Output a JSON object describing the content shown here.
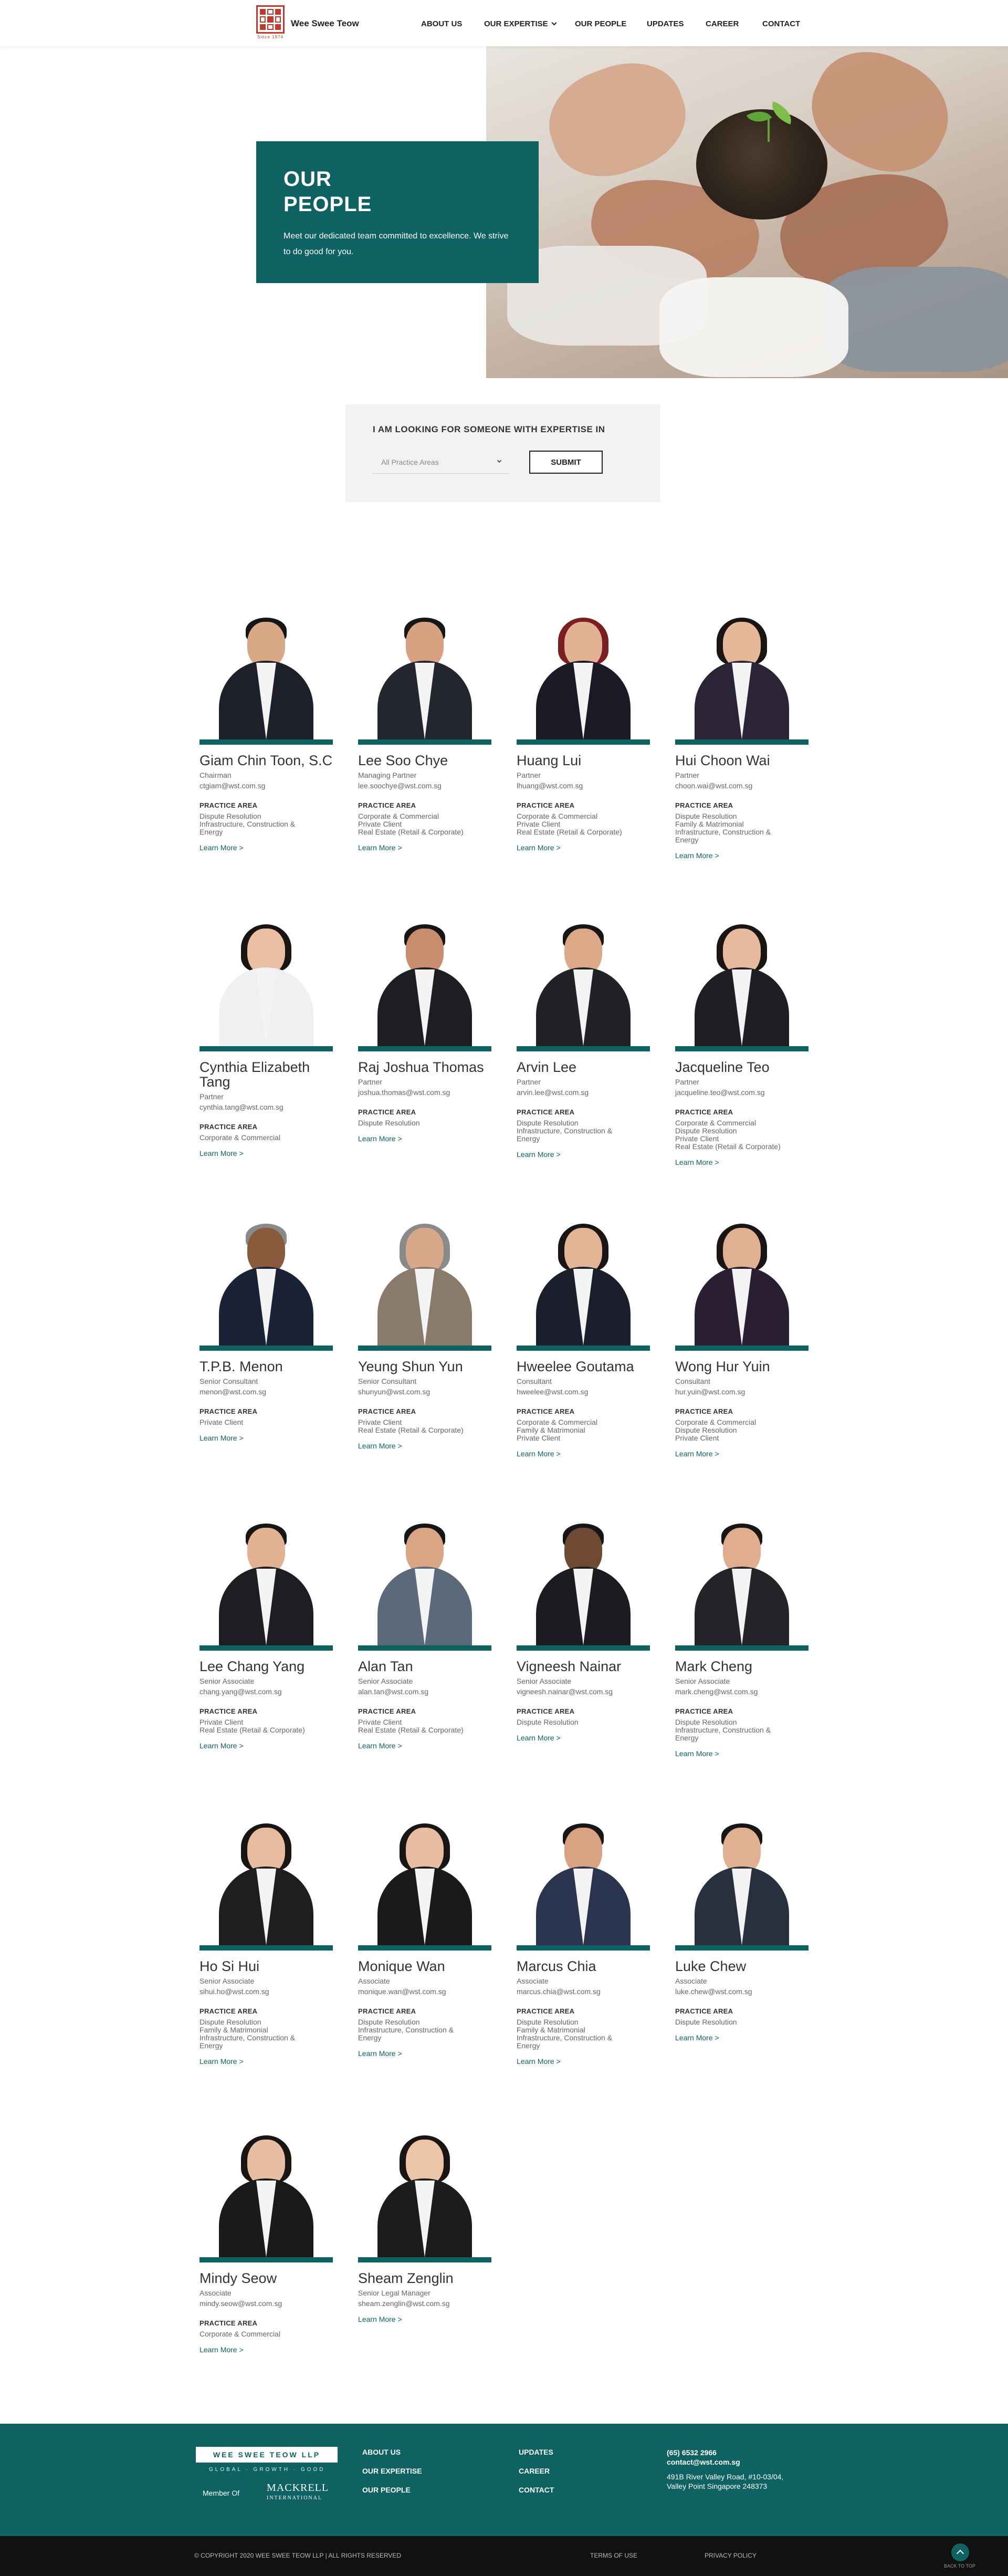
{
  "header": {
    "brand": "Wee Swee Teow",
    "logo_sub": "Since 1974",
    "nav": [
      "ABOUT US",
      "OUR EXPERTISE",
      "OUR PEOPLE",
      "UPDATES",
      "CAREER",
      "CONTACT"
    ]
  },
  "hero": {
    "title_line1": "OUR",
    "title_line2": "PEOPLE",
    "description": "Meet our dedicated team committed to excellence. We strive to do good for you."
  },
  "filter": {
    "title": "I AM LOOKING FOR SOMEONE WITH EXPERTISE IN",
    "selected": "All Practice Areas",
    "submit_label": "SUBMIT"
  },
  "labels": {
    "practice_area": "PRACTICE AREA",
    "learn_more": "Learn More >"
  },
  "people": [
    {
      "name": "Giam Chin Toon, S.C",
      "role": "Chairman",
      "email": "ctgiam@wst.com.sg",
      "areas": [
        "Dispute Resolution",
        "Infrastructure, Construction &",
        "Energy"
      ]
    },
    {
      "name": "Lee Soo Chye",
      "role": "Managing Partner",
      "email": "lee.soochye@wst.com.sg",
      "areas": [
        "Corporate & Commercial",
        "Private Client",
        "Real Estate (Retail & Corporate)"
      ]
    },
    {
      "name": "Huang Lui",
      "role": "Partner",
      "email": "lhuang@wst.com.sg",
      "areas": [
        "Corporate & Commercial",
        "Private Client",
        "Real Estate (Retail & Corporate)"
      ]
    },
    {
      "name": "Hui Choon Wai",
      "role": "Partner",
      "email": "choon.wai@wst.com.sg",
      "areas": [
        "Dispute Resolution",
        "Family & Matrimonial",
        "Infrastructure, Construction &",
        "Energy"
      ]
    },
    {
      "name": "Cynthia Elizabeth Tang",
      "role": "Partner",
      "email": "cynthia.tang@wst.com.sg",
      "areas": [
        "Corporate & Commercial"
      ]
    },
    {
      "name": "Raj Joshua Thomas",
      "role": "Partner",
      "email": "joshua.thomas@wst.com.sg",
      "areas": [
        "Dispute Resolution"
      ]
    },
    {
      "name": "Arvin Lee",
      "role": "Partner",
      "email": "arvin.lee@wst.com.sg",
      "areas": [
        "Dispute Resolution",
        "Infrastructure, Construction &",
        "Energy"
      ]
    },
    {
      "name": "Jacqueline Teo",
      "role": "Partner",
      "email": "jacqueline.teo@wst.com.sg",
      "areas": [
        "Corporate & Commercial",
        "Dispute Resolution",
        "Private Client",
        "Real Estate (Retail & Corporate)"
      ]
    },
    {
      "name": "T.P.B. Menon",
      "role": "Senior Consultant",
      "email": "menon@wst.com.sg",
      "areas": [
        "Private Client"
      ]
    },
    {
      "name": "Yeung Shun Yun",
      "role": "Senior Consultant",
      "email": "shunyun@wst.com.sg",
      "areas": [
        "Private Client",
        "Real Estate (Retail & Corporate)"
      ]
    },
    {
      "name": "Hweelee Goutama",
      "role": "Consultant",
      "email": "hweelee@wst.com.sg",
      "areas": [
        "Corporate & Commercial",
        "Family & Matrimonial",
        "Private Client"
      ]
    },
    {
      "name": "Wong Hur Yuin",
      "role": "Consultant",
      "email": "hur.yuin@wst.com.sg",
      "areas": [
        "Corporate & Commercial",
        "Dispute Resolution",
        "Private Client"
      ]
    },
    {
      "name": "Lee Chang Yang",
      "role": "Senior Associate",
      "email": "chang.yang@wst.com.sg",
      "areas": [
        "Private Client",
        "Real Estate (Retail & Corporate)"
      ]
    },
    {
      "name": "Alan Tan",
      "role": "Senior Associate",
      "email": "alan.tan@wst.com.sg",
      "areas": [
        "Private Client",
        "Real Estate (Retail & Corporate)"
      ]
    },
    {
      "name": "Vigneesh Nainar",
      "role": "Senior Associate",
      "email": "vigneesh.nainar@wst.com.sg",
      "areas": [
        "Dispute Resolution"
      ]
    },
    {
      "name": "Mark Cheng",
      "role": "Senior Associate",
      "email": "mark.cheng@wst.com.sg",
      "areas": [
        "Dispute Resolution",
        "Infrastructure, Construction &",
        "Energy"
      ]
    },
    {
      "name": "Ho Si Hui",
      "role": "Senior Associate",
      "email": "sihui.ho@wst.com.sg",
      "areas": [
        "Dispute Resolution",
        "Family & Matrimonial",
        "Infrastructure, Construction &",
        "Energy"
      ]
    },
    {
      "name": "Monique Wan",
      "role": "Associate",
      "email": "monique.wan@wst.com.sg",
      "areas": [
        "Dispute Resolution",
        "Infrastructure, Construction &",
        "Energy"
      ]
    },
    {
      "name": "Marcus Chia",
      "role": "Associate",
      "email": "marcus.chia@wst.com.sg",
      "areas": [
        "Dispute Resolution",
        "Family & Matrimonial",
        "Infrastructure, Construction &",
        "Energy"
      ]
    },
    {
      "name": "Luke Chew",
      "role": "Associate",
      "email": "luke.chew@wst.com.sg",
      "areas": [
        "Dispute Resolution"
      ]
    },
    {
      "name": "Mindy Seow",
      "role": "Associate",
      "email": "mindy.seow@wst.com.sg",
      "areas": [
        "Corporate & Commercial"
      ]
    },
    {
      "name": "Sheam Zenglin",
      "role": "Senior Legal Manager",
      "email": "sheam.zenglin@wst.com.sg",
      "areas": []
    }
  ],
  "footer": {
    "logo_text": "WEE SWEE TEOW LLP",
    "tagline": "GLOBAL · GROWTH · GOOD",
    "member_of": "Member Of",
    "mackrell": "MACKRELL",
    "mackrell_sub": "INTERNATIONAL",
    "col1": [
      "ABOUT US",
      "OUR EXPERTISE",
      "OUR PEOPLE"
    ],
    "col2": [
      "UPDATES",
      "CAREER",
      "CONTACT"
    ],
    "phone": "(65) 6532 2966",
    "email": "contact@wst.com.sg",
    "address1": "491B River Valley Road, #10-03/04,",
    "address2": "Valley Point Singapore 248373",
    "copyright": "© COPYRIGHT 2020 WEE SWEE TEOW LLP | ALL RIGHTS RESERVED",
    "terms": "TERMS OF USE",
    "privacy": "PRIVACY POLICY",
    "back_to_top": "BACK TO TOP"
  },
  "colors": {
    "accent": "#0e6362",
    "brand_red": "#c0392b"
  }
}
